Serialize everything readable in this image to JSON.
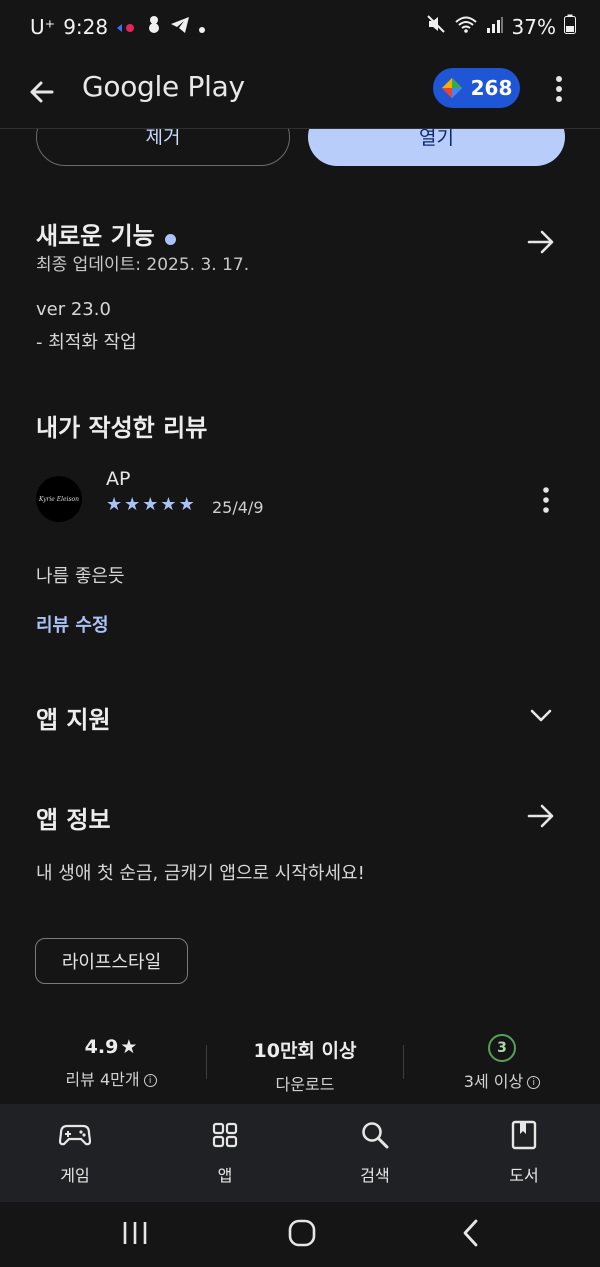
{
  "status_bar": {
    "carrier": "U⁺",
    "time": "9:28",
    "battery": "37%"
  },
  "app_bar": {
    "title": "Google Play",
    "points": "268"
  },
  "actions": {
    "remove_label": "제거",
    "open_label": "열기"
  },
  "whats_new": {
    "title": "새로운 기능",
    "updated": "최종 업데이트: 2025. 3. 17.",
    "version": "ver 23.0",
    "note": "- 최적화 작업"
  },
  "my_review": {
    "title": "내가 작성한 리뷰",
    "avatar_text": "Kyrie Eleison",
    "author": "AP",
    "rating": 5,
    "date": "25/4/9",
    "text": "나름 좋은듯",
    "edit_label": "리뷰 수정"
  },
  "app_support": {
    "title": "앱 지원"
  },
  "app_info": {
    "title": "앱 정보",
    "description": "내 생애 첫 순금, 금캐기 앱으로 시작하세요!",
    "category_chip": "라이프스타일"
  },
  "stats": {
    "rating_value": "4.9",
    "rating_sub": "리뷰 4만개",
    "downloads_value": "10만회 이상",
    "downloads_sub": "다운로드",
    "age_badge": "3",
    "age_sub": "3세 이상"
  },
  "bottom_nav": {
    "games": "게임",
    "apps": "앱",
    "search": "검색",
    "books": "도서"
  },
  "colors": {
    "background": "#151515",
    "accent": "#aac3f7",
    "open_button": "#b9cdfb",
    "points_pill": "#1f56d6"
  }
}
